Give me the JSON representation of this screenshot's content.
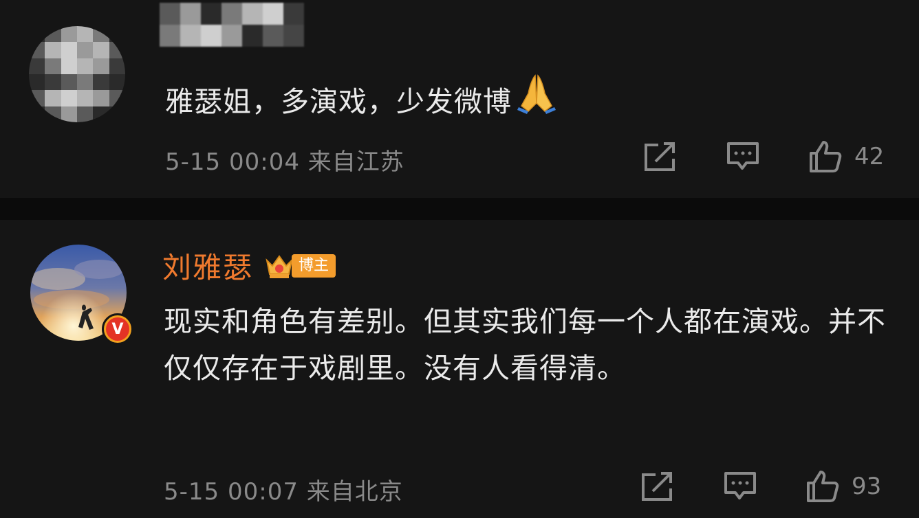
{
  "comments": [
    {
      "user": "",
      "text": "雅瑟姐，多演戏，少发微博",
      "emoji": "folded-hands-emoji",
      "time": "5-15 00:04",
      "location": "来自江苏",
      "likes": "42"
    },
    {
      "user": "刘雅瑟",
      "badge": "博主",
      "verified_mark": "V",
      "text": "现实和角色有差别。但其实我们每一个人都在演戏。并不仅仅存在于戏剧里。没有人看得清。",
      "time": "5-15 00:07",
      "location": "来自北京",
      "likes": "93"
    }
  ],
  "icons": {
    "share": "share-icon",
    "reply": "comment-icon",
    "like": "thumbs-up-icon"
  },
  "colors": {
    "background": "#151515",
    "username": "#f07a2e",
    "meta": "#8a8a8a",
    "badge": "#f39c2c"
  }
}
